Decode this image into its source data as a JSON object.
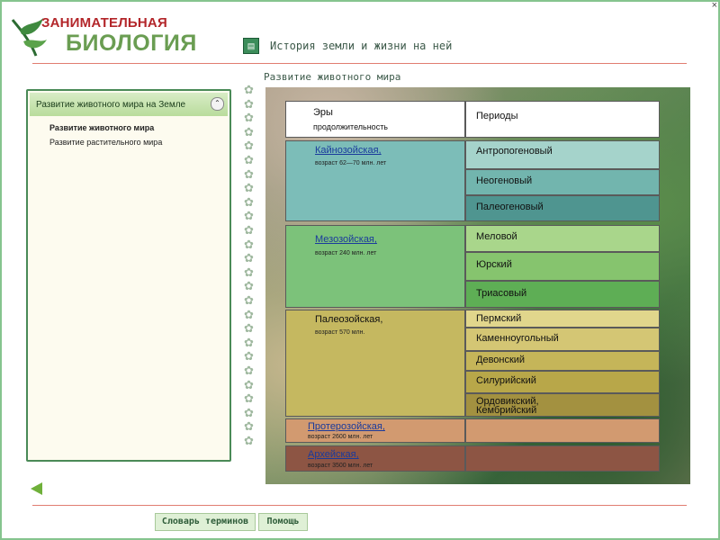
{
  "window": {
    "close_label": "×"
  },
  "logo": {
    "line1": "ЗАНИМАТЕЛЬНАЯ",
    "line2": "БИОЛОГИЯ"
  },
  "header": {
    "title": "История земли и жизни на ней"
  },
  "subtitle": "Развитие животного мира",
  "sidebar": {
    "heading": "Развитие животного мира на Земле",
    "items": [
      {
        "label": "Развитие животного мира"
      },
      {
        "label": "Развитие растительного мира"
      }
    ]
  },
  "table": {
    "eras_header": "Эры",
    "duration_header": "продолжительность",
    "periods_header": "Периоды",
    "eras": [
      {
        "name": "Кайнозойская,",
        "age": "возраст 62—70 млн. лет",
        "color": "#7cbdb8",
        "periods": [
          "Антропогеновый",
          "Неогеновый",
          "Палеогеновый"
        ],
        "period_colors": [
          "#a5d3cb",
          "#72b5ae",
          "#4f9590"
        ]
      },
      {
        "name": "Мезозойская,",
        "age": "возраст 240 млн. лет",
        "color": "#7cc27a",
        "periods": [
          "Меловой",
          "Юрский",
          "Триасовый"
        ],
        "period_colors": [
          "#a9d68b",
          "#86c46e",
          "#5eae55"
        ]
      },
      {
        "name": "Палеозойская,",
        "age": "возраст 570 млн.",
        "color": "#c5b860",
        "periods": [
          "Пермский",
          "Каменноугольный",
          "Девонский",
          "Силурийский",
          "Ордовикский, Кембрийский"
        ],
        "period_colors": [
          "#e1d68c",
          "#d4c674",
          "#c5b559",
          "#b8a749",
          "#a39140"
        ]
      },
      {
        "name": "Протерозойская,",
        "age": "возраст 2600 млн. лет",
        "color": "#d29a70",
        "periods": [],
        "period_colors": []
      },
      {
        "name": "Архейская,",
        "age": "возраст 3500 млн. лет",
        "color": "#8d5544",
        "periods": [],
        "period_colors": []
      }
    ]
  },
  "footer": {
    "glossary_label": "Словарь терминов",
    "help_label": "Помощь"
  },
  "colors": {
    "accent_green": "#4a8a57",
    "rule_red": "#e17d71",
    "logo_red": "#b3262a",
    "logo_green": "#6a9d52"
  }
}
